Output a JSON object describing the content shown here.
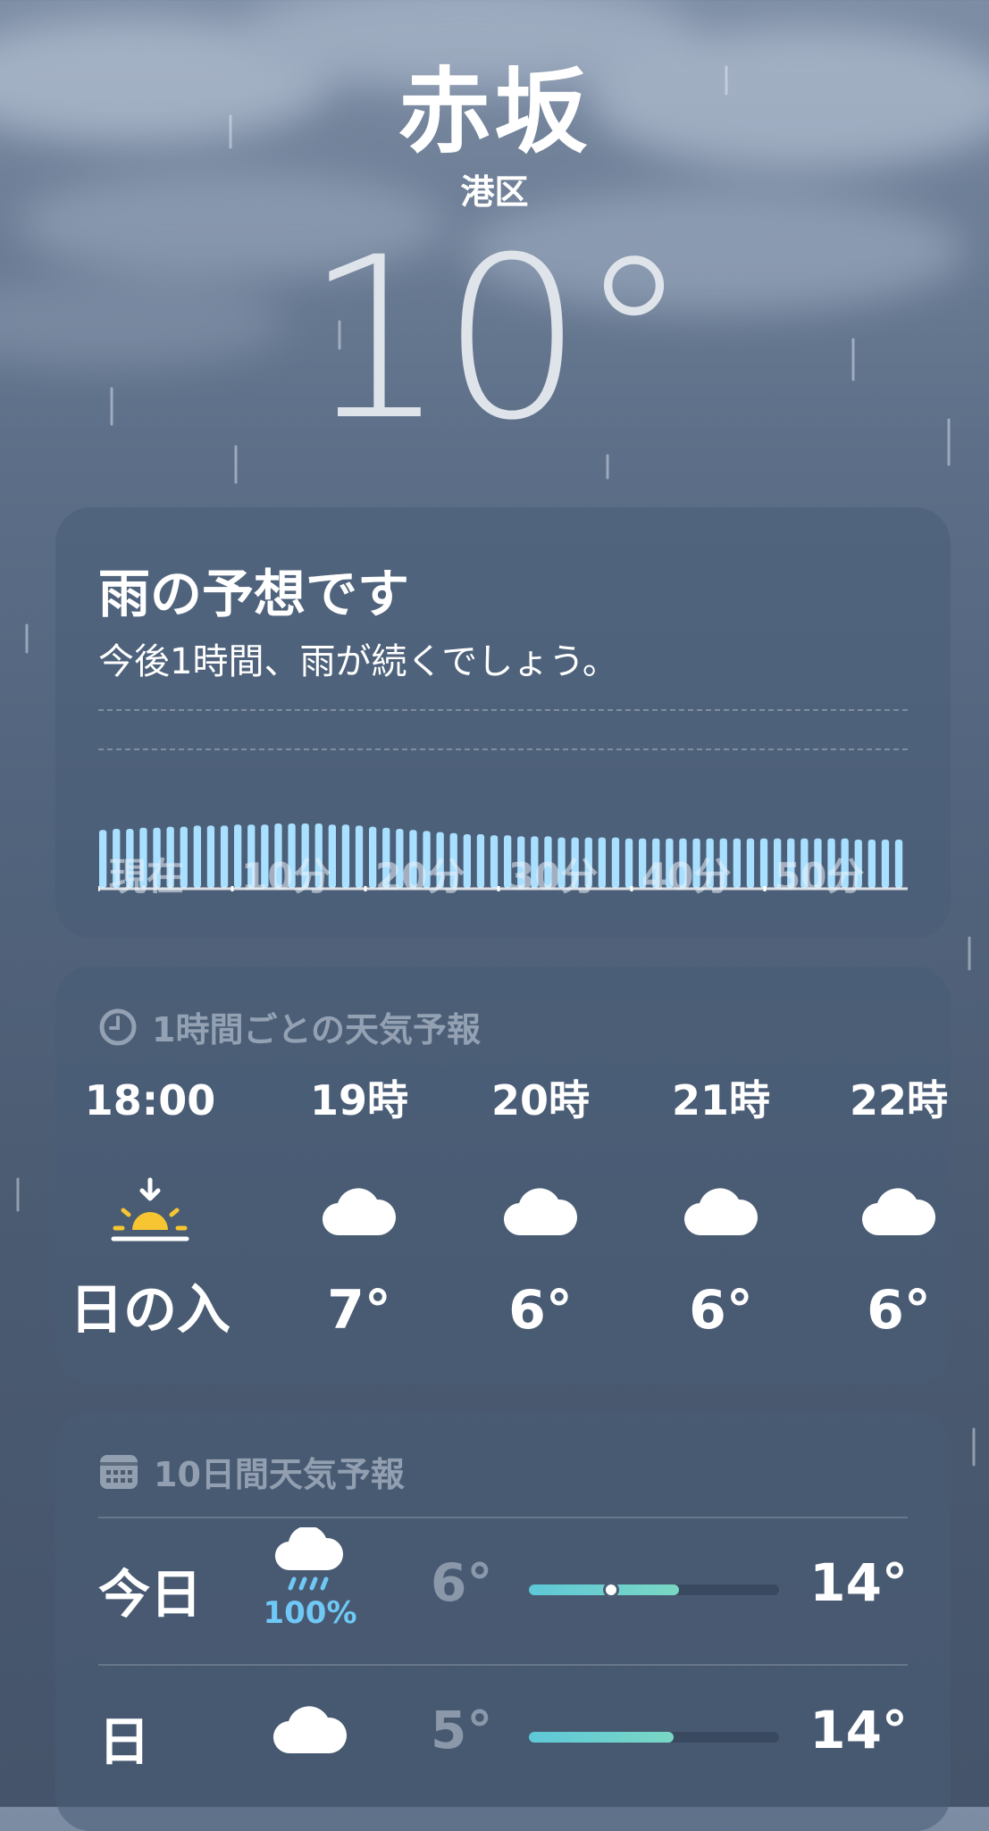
{
  "location": {
    "city": "赤坂",
    "district": "港区",
    "temperature": "10°"
  },
  "rain_card": {
    "title": "雨の予想です",
    "subtitle": "今後1時間、雨が続くでしょう。",
    "axis_labels": [
      "現在",
      "10分",
      "20分",
      "30分",
      "40分",
      "50分"
    ],
    "intensity": [
      0.54,
      0.55,
      0.55,
      0.56,
      0.56,
      0.57,
      0.57,
      0.58,
      0.58,
      0.58,
      0.59,
      0.59,
      0.59,
      0.6,
      0.6,
      0.6,
      0.6,
      0.59,
      0.59,
      0.58,
      0.57,
      0.56,
      0.55,
      0.54,
      0.53,
      0.52,
      0.51,
      0.5,
      0.5,
      0.49,
      0.49,
      0.48,
      0.48,
      0.48,
      0.47,
      0.47,
      0.47,
      0.47,
      0.47,
      0.46,
      0.46,
      0.46,
      0.46,
      0.46,
      0.46,
      0.46,
      0.46,
      0.46,
      0.46,
      0.46,
      0.46,
      0.46,
      0.46,
      0.46,
      0.46,
      0.46,
      0.45,
      0.45,
      0.45,
      0.45
    ],
    "colors": {
      "bar": "#a9e0ff"
    }
  },
  "hourly": {
    "heading": "1時間ごとの天気予報",
    "heading_icon": "clock-icon",
    "items": [
      {
        "time": "18:00",
        "icon": "sunset-icon",
        "temp": "日の入"
      },
      {
        "time": "19時",
        "icon": "cloud-icon",
        "temp": "7°"
      },
      {
        "time": "20時",
        "icon": "cloud-icon",
        "temp": "6°"
      },
      {
        "time": "21時",
        "icon": "cloud-icon",
        "temp": "6°"
      },
      {
        "time": "22時",
        "icon": "cloud-icon",
        "temp": "6°"
      }
    ]
  },
  "daily": {
    "heading": "10日間天気予報",
    "heading_icon": "calendar-icon",
    "days": [
      {
        "day": "今日",
        "icon": "cloud-rain-icon",
        "precip": "100%",
        "low": "6°",
        "high": "14°",
        "range": [
          0.0,
          0.6
        ],
        "current": 0.33
      },
      {
        "day": "日",
        "icon": "cloud-icon",
        "precip": "",
        "low": "5°",
        "high": "14°",
        "range": [
          0.0,
          0.58
        ]
      }
    ]
  }
}
